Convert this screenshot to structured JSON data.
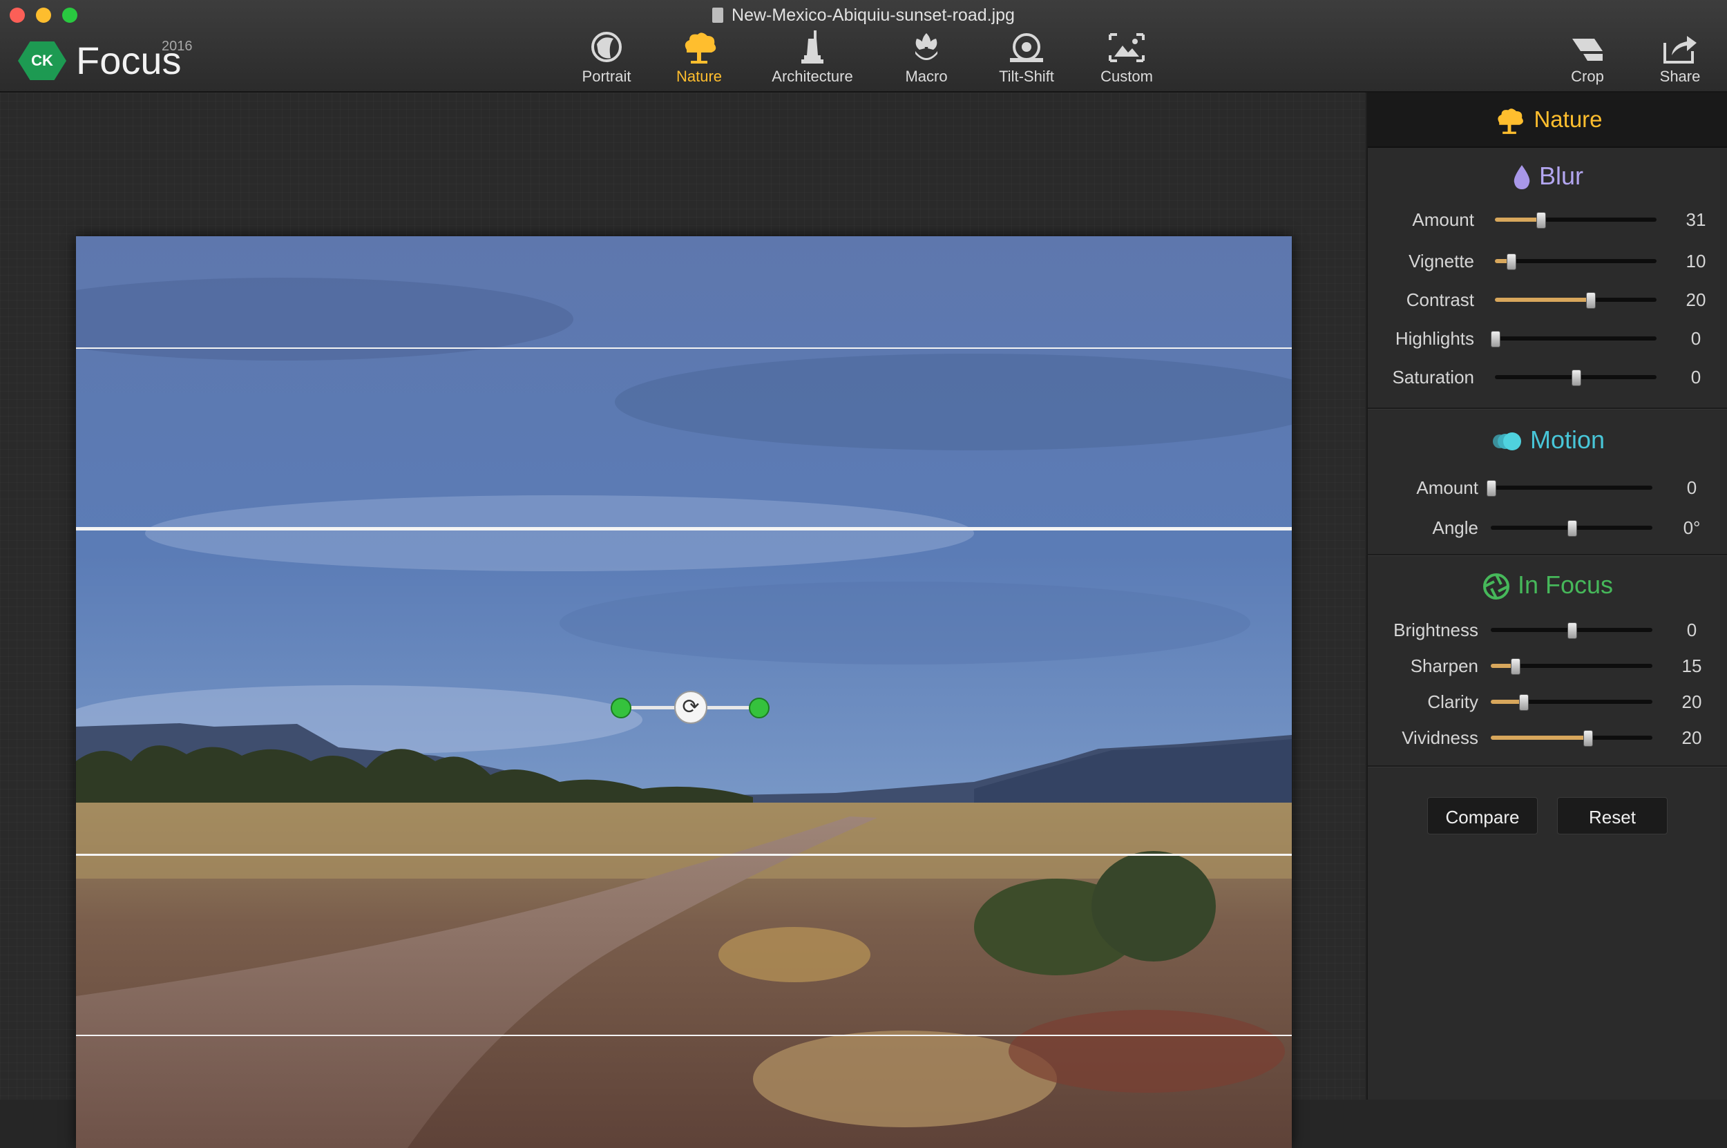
{
  "window": {
    "file_name": "New-Mexico-Abiquiu-sunset-road.jpg"
  },
  "brand": {
    "badge": "CK",
    "name": "Focus",
    "year": "2016"
  },
  "modes": [
    {
      "label": "Portrait",
      "icon": "portrait-icon",
      "active": false
    },
    {
      "label": "Nature",
      "icon": "tree-icon",
      "active": true
    },
    {
      "label": "Architecture",
      "icon": "statue-icon",
      "active": false
    },
    {
      "label": "Macro",
      "icon": "flower-icon",
      "active": false
    },
    {
      "label": "Tilt-Shift",
      "icon": "tilt-shift-icon",
      "active": false
    },
    {
      "label": "Custom",
      "icon": "custom-frame-icon",
      "active": false
    }
  ],
  "tools": [
    {
      "label": "Crop",
      "icon": "crop-icon"
    },
    {
      "label": "Share",
      "icon": "share-icon"
    }
  ],
  "panel": {
    "header": "Nature",
    "blur": {
      "title": "Blur",
      "color": "#b3a6f0",
      "sliders": [
        {
          "label": "Amount",
          "value": "31",
          "level": 0.28,
          "fill": true
        },
        {
          "label": "Vignette",
          "value": "10",
          "level": 0.1,
          "fill": true
        },
        {
          "label": "Contrast",
          "value": "20",
          "level": 0.59,
          "fill": true
        },
        {
          "label": "Highlights",
          "value": "0",
          "level": 0.0,
          "fill": false
        },
        {
          "label": "Saturation",
          "value": "0",
          "level": 0.5,
          "fill": false
        }
      ]
    },
    "motion": {
      "title": "Motion",
      "color": "#48c6d8",
      "sliders": [
        {
          "label": "Amount",
          "value": "0",
          "level": 0.0,
          "fill": false
        },
        {
          "label": "Angle",
          "value": "0°",
          "level": 0.5,
          "fill": false
        }
      ]
    },
    "in_focus": {
      "title": "In Focus",
      "color": "#46b85a",
      "sliders": [
        {
          "label": "Brightness",
          "value": "0",
          "level": 0.5,
          "fill": false
        },
        {
          "label": "Sharpen",
          "value": "15",
          "level": 0.15,
          "fill": true
        },
        {
          "label": "Clarity",
          "value": "20",
          "level": 0.2,
          "fill": true
        },
        {
          "label": "Vividness",
          "value": "20",
          "level": 0.6,
          "fill": true
        }
      ]
    },
    "buttons": {
      "compare": "Compare",
      "reset": "Reset"
    }
  },
  "colors": {
    "accent": "#ffbe2e",
    "slider_fill": "#d8a75c",
    "handle_green": "#35c23d"
  }
}
